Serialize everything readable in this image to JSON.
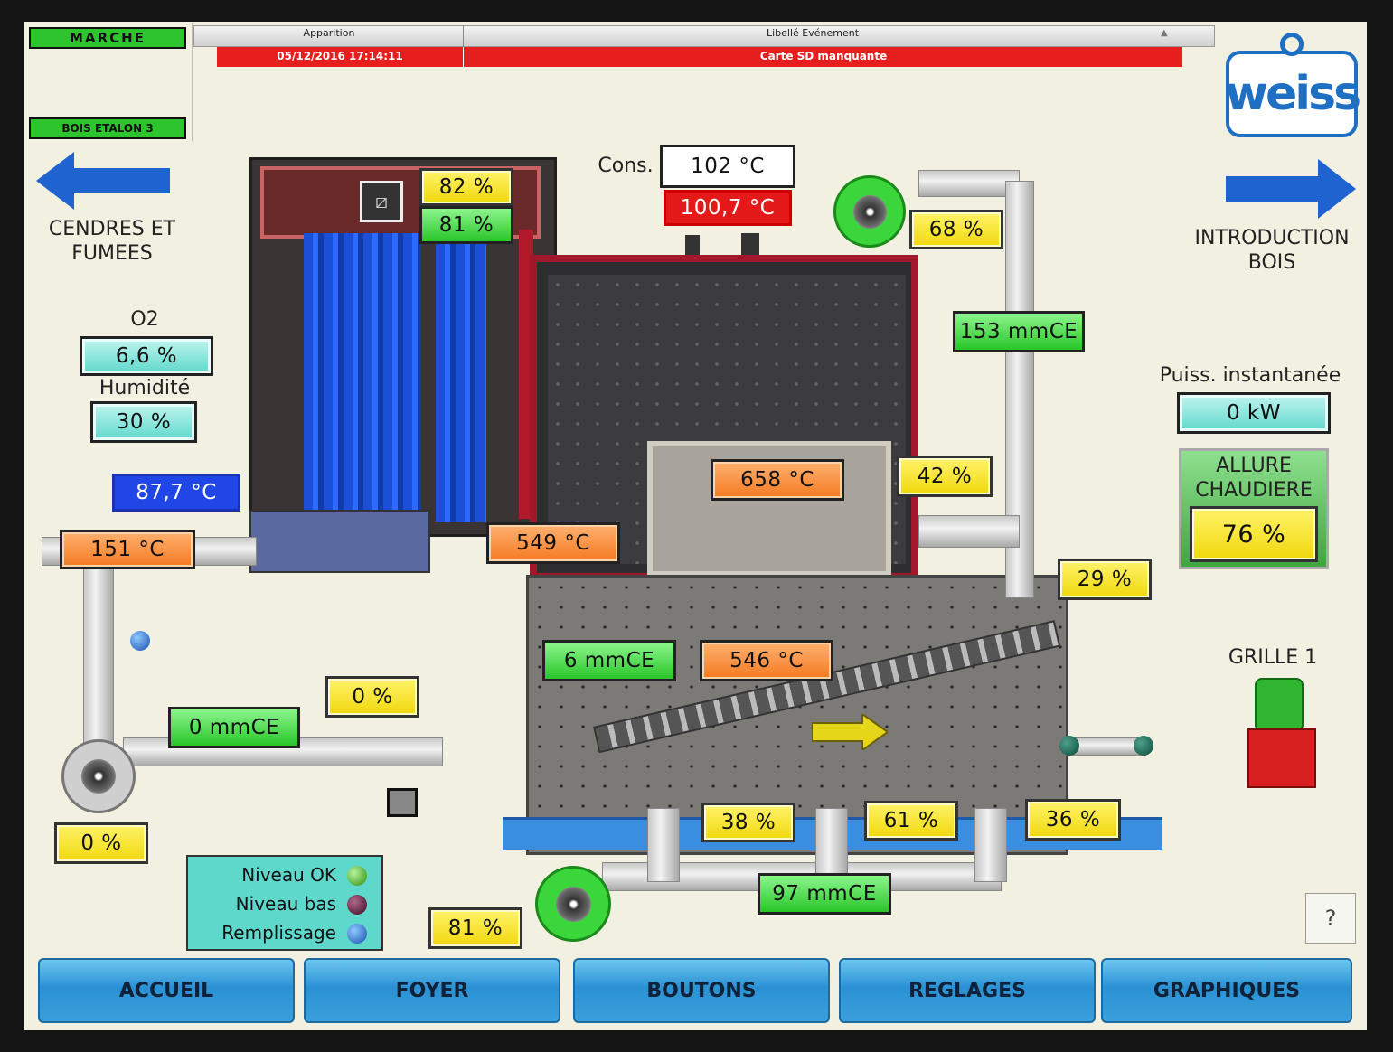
{
  "status": {
    "mode": "MARCHE",
    "fuel": "BOIS ETALON 3"
  },
  "alarm": {
    "col_time": "Apparition",
    "col_event": "Libellé Evénement",
    "row_time": "05/12/2016 17:14:11",
    "row_event": "Carte SD manquante"
  },
  "brand": "weiss",
  "nav_left": {
    "line1": "CENDRES ET",
    "line2": "FUMEES"
  },
  "nav_right": {
    "line1": "INTRODUCTION",
    "line2": "BOIS"
  },
  "o2": {
    "label": "O2",
    "value": "6,6 %"
  },
  "humidity": {
    "label": "Humidité",
    "value": "30 %"
  },
  "temp_blue": "87,7 °C",
  "temp_fumes": "151 °C",
  "exchanger": {
    "top": "82 %",
    "bottom": "81 %"
  },
  "consigne": {
    "label": "Cons.",
    "setpoint": "102 °C",
    "actual": "100,7 °C"
  },
  "fan_top_pct": "68 %",
  "pressure_top": "153 mmCE",
  "power": {
    "label": "Puiss. instantanée",
    "value": "0 kW"
  },
  "allure": {
    "line1": "ALLURE",
    "line2": "CHAUDIERE",
    "value": "76 %"
  },
  "furnace": {
    "temp_top": "658 °C",
    "temp_mid": "549 °C",
    "temp_low": "546 °C",
    "pressure": "6 mmCE"
  },
  "damper_right": "42 %",
  "damper_right2": "29 %",
  "grille": {
    "label": "GRILLE 1"
  },
  "left_circuit": {
    "pct_top": "0 %",
    "pressure": "0 mmCE",
    "fan_pct": "0 %"
  },
  "under_grate": {
    "a": "38 %",
    "b": "61 %",
    "c": "36 %",
    "pressure": "97 mmCE",
    "fan_pct": "81 %"
  },
  "legend": {
    "ok": "Niveau OK",
    "low": "Niveau bas",
    "fill": "Remplissage"
  },
  "help": "?",
  "menu": [
    "ACCUEIL",
    "FOYER",
    "BOUTONS",
    "REGLAGES",
    "GRAPHIQUES"
  ],
  "colors": {
    "accent_blue": "#2046e8",
    "alarm_red": "#e41a1a",
    "running_green": "#2ec42e",
    "panel_bg": "#f2f0e0"
  }
}
